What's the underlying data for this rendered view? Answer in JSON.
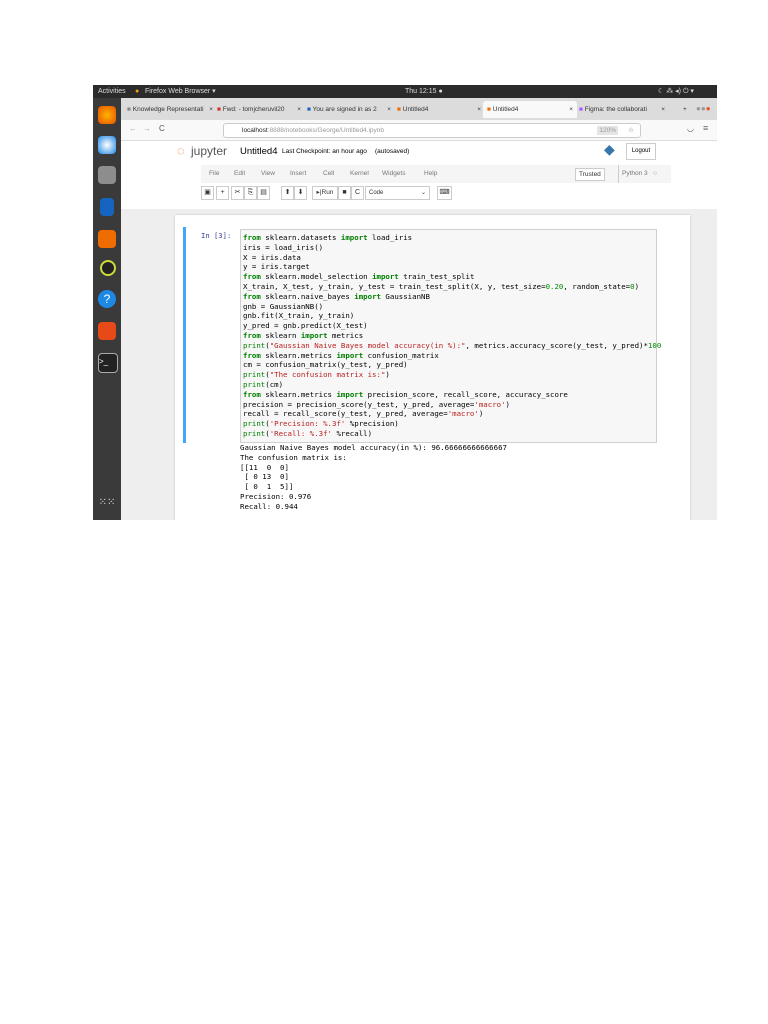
{
  "topbar": {
    "activities": "Activities",
    "app": "Firefox Web Browser ▾",
    "clock": "Thu 12:15 ●",
    "tray": "☾ ⁂ ◂) ⏻ ▾"
  },
  "tabs": [
    {
      "label": "Knowledge Representati",
      "close": "×"
    },
    {
      "label": "Fwd: - tomjcheruvil20",
      "close": "×"
    },
    {
      "label": "You are signed in as 2",
      "close": "×"
    },
    {
      "label": "Untitled4",
      "close": "×"
    },
    {
      "label": "Untitled4",
      "close": "×"
    },
    {
      "label": "Figma: the collaborati",
      "close": "×"
    }
  ],
  "new_tab": "+",
  "nav": {
    "back": "←",
    "forward": "→",
    "reload": "C"
  },
  "url": {
    "host": "localhost",
    "path": ":8888/notebooks/George/Untitled4.ipynb",
    "zoom": "120%"
  },
  "jupyter": {
    "logo": "jupyter",
    "title": "Untitled4",
    "checkpoint": "Last Checkpoint: an hour ago",
    "saved": "(autosaved)",
    "logout": "Logout",
    "trusted": "Trusted",
    "kernel": "Python 3"
  },
  "menu": [
    "File",
    "Edit",
    "View",
    "Insert",
    "Cell",
    "Kernel",
    "Widgets",
    "Help"
  ],
  "toolbar": {
    "run": "Run",
    "cell_type": "Code"
  },
  "cell": {
    "prompt": "In [3]:",
    "code": [
      [
        [
          "from",
          "k"
        ],
        [
          " sklearn.datasets ",
          ""
        ],
        [
          "import",
          "k"
        ],
        [
          " load_iris",
          ""
        ]
      ],
      [
        [
          "iris = load_iris()",
          ""
        ]
      ],
      [
        [
          "X = iris.data",
          ""
        ]
      ],
      [
        [
          "y = iris.target",
          ""
        ]
      ],
      [
        [
          "from",
          "k"
        ],
        [
          " sklearn.model_selection ",
          ""
        ],
        [
          "import",
          "k"
        ],
        [
          " train_test_split",
          ""
        ]
      ],
      [
        [
          "X_train, X_test, y_train, y_test = train_test_split(X, y, test_size=",
          ""
        ],
        [
          "0.20",
          "n"
        ],
        [
          ", random_state=",
          ""
        ],
        [
          "0",
          "n"
        ],
        [
          ")",
          ""
        ]
      ],
      [
        [
          "from",
          "k"
        ],
        [
          " sklearn.naive_bayes ",
          ""
        ],
        [
          "import",
          "k"
        ],
        [
          " GaussianNB",
          ""
        ]
      ],
      [
        [
          "gnb = GaussianNB()",
          ""
        ]
      ],
      [
        [
          "gnb.fit(X_train, y_train)",
          ""
        ]
      ],
      [
        [
          "y_pred = gnb.predict(X_test)",
          ""
        ]
      ],
      [
        [
          "from",
          "k"
        ],
        [
          " sklearn ",
          ""
        ],
        [
          "import",
          "k"
        ],
        [
          " metrics",
          ""
        ]
      ],
      [
        [
          "print",
          "b"
        ],
        [
          "(",
          ""
        ],
        [
          "\"Gaussian Naive Bayes model accuracy(in %):\"",
          "s"
        ],
        [
          ", metrics.accuracy_score(y_test, y_pred)*",
          ""
        ],
        [
          "100",
          "n"
        ]
      ],
      [
        [
          "from",
          "k"
        ],
        [
          " sklearn.metrics ",
          ""
        ],
        [
          "import",
          "k"
        ],
        [
          " confusion_matrix",
          ""
        ]
      ],
      [
        [
          "cm = confusion_matrix(y_test, y_pred)",
          ""
        ]
      ],
      [
        [
          "print",
          "b"
        ],
        [
          "(",
          ""
        ],
        [
          "\"The confusion matrix is:\"",
          "s"
        ],
        [
          ")",
          ""
        ]
      ],
      [
        [
          "print",
          "b"
        ],
        [
          "(cm)",
          ""
        ]
      ],
      [
        [
          "from",
          "k"
        ],
        [
          " sklearn.metrics ",
          ""
        ],
        [
          "import",
          "k"
        ],
        [
          " precision_score, recall_score, accuracy_score",
          ""
        ]
      ],
      [
        [
          "precision = precision_score(y_test, y_pred, average=",
          ""
        ],
        [
          "'macro'",
          "s"
        ],
        [
          ")",
          ""
        ]
      ],
      [
        [
          "recall = recall_score(y_test, y_pred, average=",
          ""
        ],
        [
          "'macro'",
          "s"
        ],
        [
          ")",
          ""
        ]
      ],
      [
        [
          "print",
          "b"
        ],
        [
          "(",
          ""
        ],
        [
          "'Precision: %.3f'",
          "s"
        ],
        [
          " %precision)",
          ""
        ]
      ],
      [
        [
          "print",
          "b"
        ],
        [
          "(",
          ""
        ],
        [
          "'Recall: %.3f'",
          "s"
        ],
        [
          " %recall)",
          ""
        ]
      ]
    ],
    "output": "Gaussian Naive Bayes model accuracy(in %): 96.66666666666667\nThe confusion matrix is:\n[[11  0  0]\n [ 0 13  0]\n [ 0  1  5]]\nPrecision: 0.976\nRecall: 0.944"
  }
}
